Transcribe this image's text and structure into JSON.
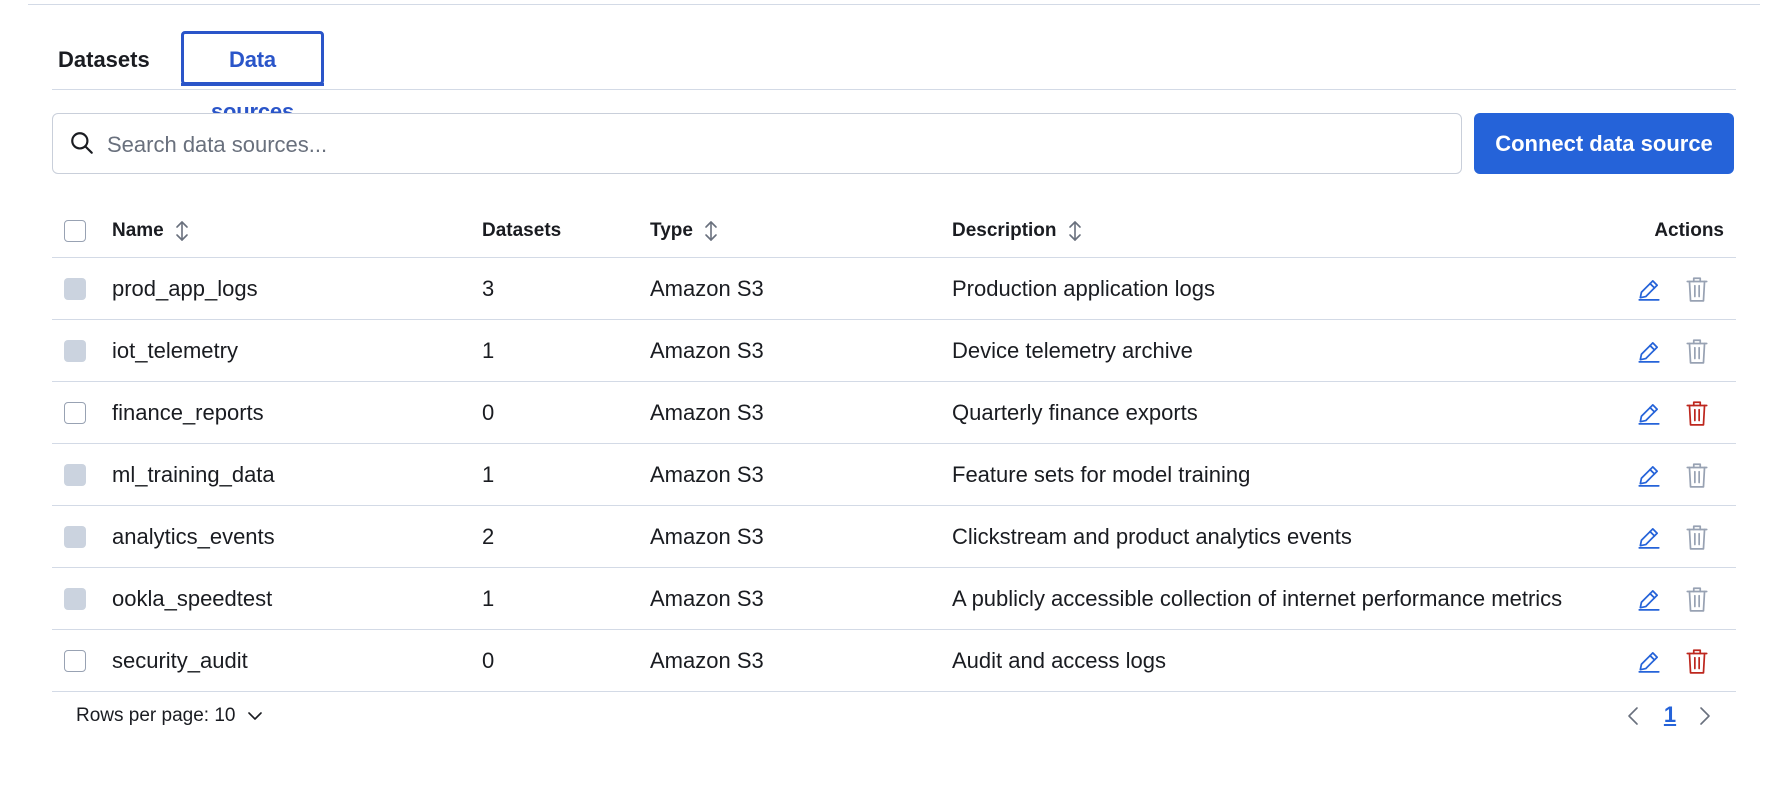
{
  "tabs": [
    {
      "label": "Datasets",
      "active": false
    },
    {
      "label": "Data sources",
      "active": true
    }
  ],
  "search": {
    "placeholder": "Search data sources...",
    "value": ""
  },
  "connect_button": {
    "label": "Connect data source"
  },
  "table": {
    "headers": {
      "name": "Name",
      "datasets": "Datasets",
      "type": "Type",
      "description": "Description",
      "actions": "Actions"
    },
    "rows": [
      {
        "name": "prod_app_logs",
        "datasets": "3",
        "type": "Amazon S3",
        "description": "Production application logs",
        "deletable": false
      },
      {
        "name": "iot_telemetry",
        "datasets": "1",
        "type": "Amazon S3",
        "description": "Device telemetry archive",
        "deletable": false
      },
      {
        "name": "finance_reports",
        "datasets": "0",
        "type": "Amazon S3",
        "description": "Quarterly finance exports",
        "deletable": true
      },
      {
        "name": "ml_training_data",
        "datasets": "1",
        "type": "Amazon S3",
        "description": "Feature sets for model training",
        "deletable": false
      },
      {
        "name": "analytics_events",
        "datasets": "2",
        "type": "Amazon S3",
        "description": "Clickstream and product analytics events",
        "deletable": false
      },
      {
        "name": "ookla_speedtest",
        "datasets": "1",
        "type": "Amazon S3",
        "description": "A publicly accessible collection of internet performance metrics",
        "deletable": false
      },
      {
        "name": "security_audit",
        "datasets": "0",
        "type": "Amazon S3",
        "description": "Audit and access logs",
        "deletable": true
      }
    ]
  },
  "pagination": {
    "rows_per_page_label": "Rows per page: 10",
    "current_page": "1"
  },
  "icons": {
    "search": "search-icon",
    "sort": "sort-icon",
    "edit": "pencil-icon",
    "delete": "trash-icon",
    "chevron_down": "chevron-down-icon",
    "prev": "chevron-left-icon",
    "next": "chevron-right-icon"
  },
  "colors": {
    "accent": "#2563d9",
    "tab_active": "#2a55c9",
    "delete_enabled": "#bd271e",
    "delete_disabled": "#98a2b3",
    "checkbox_disabled": "#cbd3df"
  }
}
